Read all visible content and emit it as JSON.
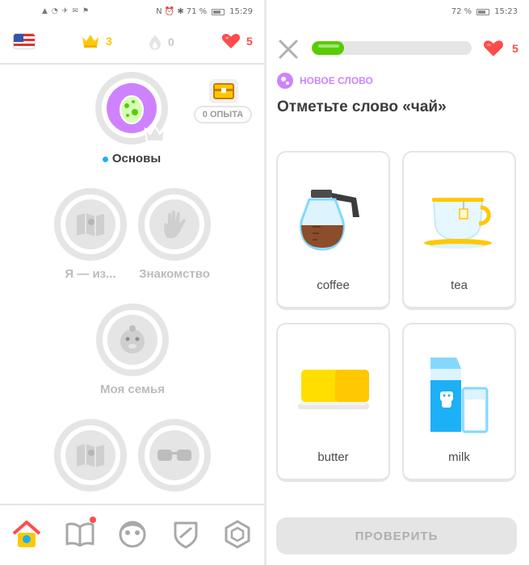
{
  "left_screen": {
    "status_bar": {
      "battery_percent": "71 %",
      "time": "15:29"
    },
    "header": {
      "course_flag_icon": "us-flag-icon",
      "crowns": "3",
      "streak": "0",
      "hearts": "5"
    },
    "skills": [
      {
        "label": "Основы",
        "icon": "egg-icon",
        "active": true
      },
      {
        "label": "Я — из...",
        "icon": "map-icon",
        "active": false
      },
      {
        "label": "Знакомство",
        "icon": "hand-wave-icon",
        "active": false
      },
      {
        "label": "Моя семья",
        "icon": "baby-icon",
        "active": false
      },
      {
        "label": "",
        "icon": "map-icon",
        "active": false
      },
      {
        "label": "",
        "icon": "sunglasses-icon",
        "active": false
      }
    ],
    "chest": {
      "label": "0 ОПЫТА"
    },
    "tabs": [
      "home-icon",
      "book-icon",
      "profile-icon",
      "shield-icon",
      "shop-icon"
    ]
  },
  "right_screen": {
    "status_bar": {
      "battery_percent": "72 %",
      "time": "15:23"
    },
    "progress": 0.2,
    "hearts": "5",
    "new_word_label": "НОВОЕ СЛОВО",
    "prompt": "Отметьте слово «чай»",
    "options": [
      {
        "word": "coffee",
        "icon": "coffee-pot-icon"
      },
      {
        "word": "tea",
        "icon": "tea-cup-icon"
      },
      {
        "word": "butter",
        "icon": "butter-icon"
      },
      {
        "word": "milk",
        "icon": "milk-icon"
      }
    ],
    "check_button": "ПРОВЕРИТЬ"
  },
  "colors": {
    "crown": "#ffc800",
    "heart": "#ff4b4b",
    "progress": "#58cc02",
    "new_word": "#ce82ff",
    "active_skill": "#ce82ff"
  }
}
